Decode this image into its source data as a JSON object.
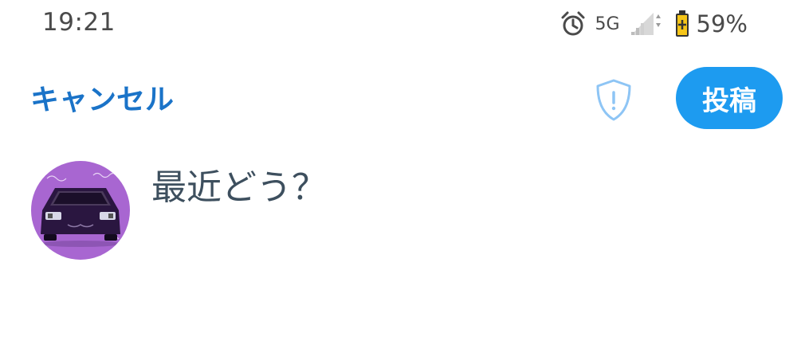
{
  "status_bar": {
    "time": "19:21",
    "network_type": "5G",
    "battery_percent": "59%",
    "icons": [
      "alarm-icon",
      "signal-icon",
      "battery-icon"
    ]
  },
  "toolbar": {
    "cancel_label": "キャンセル",
    "shield_icon": "shield-alert-icon",
    "post_label": "投稿"
  },
  "composer": {
    "avatar_icon": "car-avatar",
    "placeholder": "最近どう？"
  },
  "colors": {
    "accent": "#1d9bf0",
    "cancel_text": "#1a73c8",
    "shield_outline": "#8ec5f5",
    "avatar_bg": "#a866d1",
    "status_text": "#4a4a4a",
    "placeholder_text": "#3d4f5e"
  }
}
